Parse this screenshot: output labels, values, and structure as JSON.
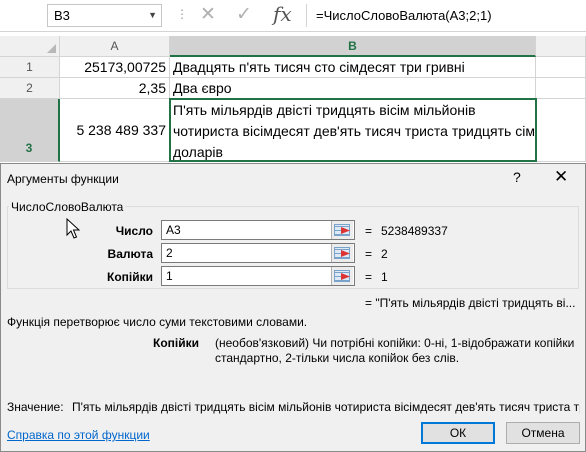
{
  "formula_bar": {
    "name_box": "B3",
    "name_box_arrow": "▼",
    "separator": "⋮",
    "cancel_icon": "✕",
    "enter_icon": "✓",
    "fx_label": "fx",
    "formula": "=ЧислоСловоВалюта(A3;2;1)"
  },
  "sheet": {
    "columns": [
      "A",
      "B"
    ],
    "rows": [
      {
        "num": "1",
        "a": "25173,00725",
        "b": "Двадцять п'ять тисяч сто сімдесят три гривні"
      },
      {
        "num": "2",
        "a": "2,35",
        "b": "Два євро"
      },
      {
        "num": "3",
        "a": "5 238 489 337",
        "b": "П'ять мільярдів двісті тридцять вісім мільйонів чотириста вісімдесят дев'ять тисяч триста тридцять сім доларів"
      }
    ]
  },
  "dialog": {
    "title": "Аргументы функции",
    "help": "?",
    "close": "✕",
    "function_name": "ЧислоСловоВалюта",
    "args": [
      {
        "label": "Число",
        "value": "A3",
        "result": "5238489337"
      },
      {
        "label": "Валюта",
        "value": "2",
        "result": "2"
      },
      {
        "label": "Копійки",
        "value": "1",
        "result": "1"
      }
    ],
    "equals": "=",
    "result_line": "=  \"П'ять мільярдів двісті тридцять ві...",
    "function_description": "Функція перетворює число суми текстовими словами.",
    "arg_help_name": "Копійки",
    "arg_help_text": "(необов'язковий) Чи потрібні копійки: 0-ні, 1-відображати копійки стандартно, 2-тільки числа копійок без слів.",
    "value_label": "Значение:",
    "value_text": "П'ять мільярдів двісті тридцять вісім мільйонів чотириста вісімдесят дев'ять тисяч триста тридцять сім доларів",
    "help_link": "Справка по этой функции",
    "ok": "ОК",
    "cancel": "Отмена"
  }
}
